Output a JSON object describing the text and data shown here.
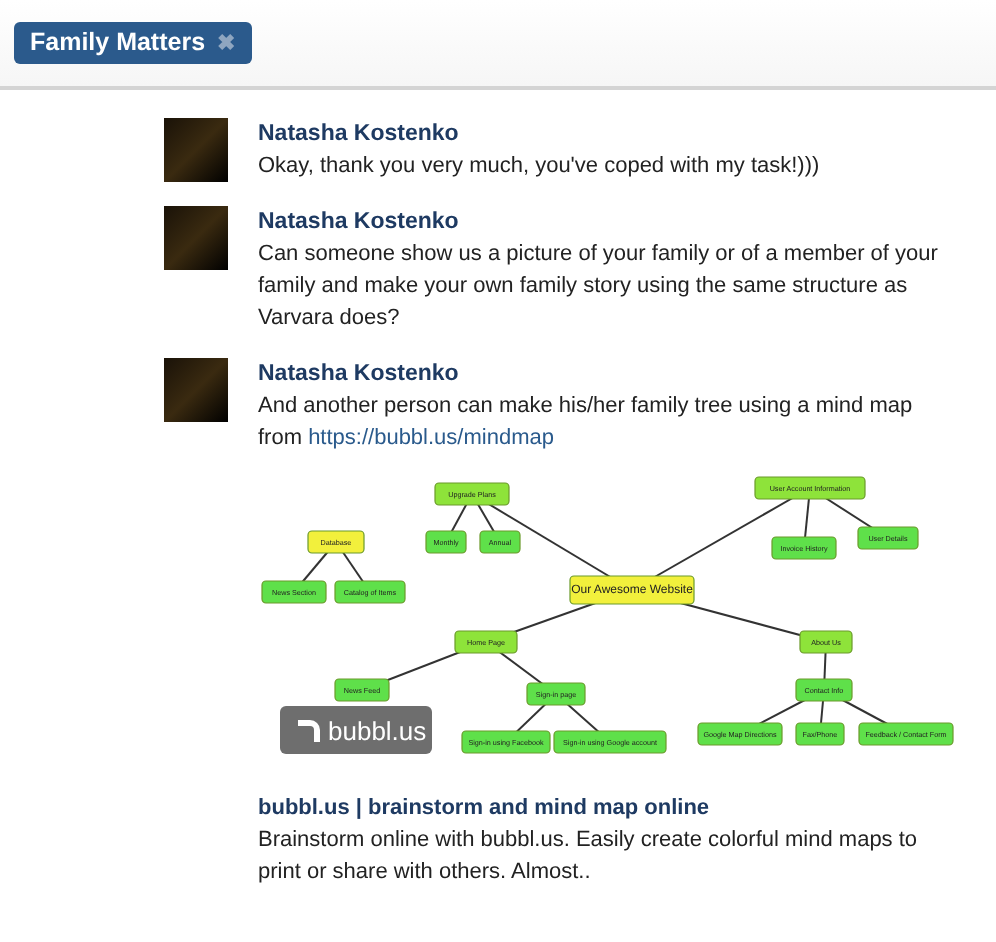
{
  "tab": {
    "label": "Family Matters",
    "close": "✖"
  },
  "messages": [
    {
      "author": "Natasha Kostenko",
      "text": "Okay, thank you very much, you've coped with my task!)))"
    },
    {
      "author": "Natasha Kostenko",
      "text": "Can someone show us a picture of your family or of a member of your family and make your own family story using the same structure as Varvara does?"
    },
    {
      "author": "Natasha Kostenko",
      "text": "And another person can make his/her family tree using a mind map from",
      "link": "https://bubbl.us/mindmap",
      "preview": {
        "mind_map": {
          "trees": [
            {
              "label": "Our Awesome Website",
              "color": "#f2f03c",
              "children": [
                {
                  "label": "Upgrade Plans",
                  "color": "#8ee33a",
                  "children": [
                    {
                      "label": "Monthly",
                      "color": "#5fe04a"
                    },
                    {
                      "label": "Annual",
                      "color": "#5fe04a"
                    }
                  ]
                },
                {
                  "label": "User Account Information",
                  "color": "#8ee33a",
                  "children": [
                    {
                      "label": "Invoice History",
                      "color": "#5fe04a"
                    },
                    {
                      "label": "User Details",
                      "color": "#5fe04a"
                    }
                  ]
                },
                {
                  "label": "Home Page",
                  "color": "#8ee33a",
                  "children": [
                    {
                      "label": "News Feed",
                      "color": "#5fe04a"
                    },
                    {
                      "label": "Sign-in page",
                      "color": "#5fe04a",
                      "children": [
                        {
                          "label": "Sign-in using Facebook",
                          "color": "#5fe04a"
                        },
                        {
                          "label": "Sign-in using Google account",
                          "color": "#5fe04a"
                        }
                      ]
                    }
                  ]
                },
                {
                  "label": "About Us",
                  "color": "#8ee33a",
                  "children": [
                    {
                      "label": "Contact Info",
                      "color": "#5fe04a",
                      "children": [
                        {
                          "label": "Google Map Directions",
                          "color": "#5fe04a"
                        },
                        {
                          "label": "Fax/Phone",
                          "color": "#5fe04a"
                        },
                        {
                          "label": "Feedback / Contact Form",
                          "color": "#5fe04a"
                        }
                      ]
                    }
                  ]
                }
              ]
            },
            {
              "label": "Database",
              "color": "#f2f03c",
              "children": [
                {
                  "label": "News Section",
                  "color": "#5fe04a"
                },
                {
                  "label": "Catalog of Items",
                  "color": "#5fe04a"
                }
              ]
            }
          ]
        },
        "badge": "bubbl.us",
        "title": "bubbl.us | brainstorm and mind map online",
        "description": "Brainstorm online with bubbl.us. Easily create colorful mind maps to print or share with others. Almost.."
      }
    }
  ]
}
